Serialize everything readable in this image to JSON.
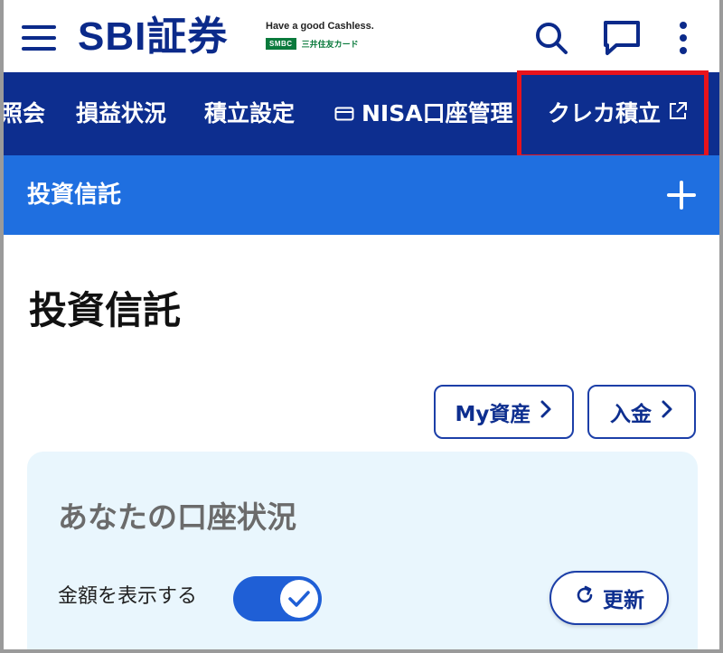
{
  "header": {
    "logo": "SBI証券",
    "tagline": "Have a good Cashless.",
    "smbc": "SMBC",
    "card_company": "三井住友カード"
  },
  "nav": {
    "items": [
      {
        "label": "照会"
      },
      {
        "label": "損益状況"
      },
      {
        "label": "積立設定"
      },
      {
        "label": "NISA口座管理"
      },
      {
        "label": "クレカ積立"
      }
    ]
  },
  "accordion": {
    "title": "投資信託"
  },
  "main": {
    "page_title": "投資信託",
    "my_assets_label": "My資産",
    "deposit_label": "入金",
    "account_card": {
      "title": "あなたの口座状況",
      "toggle_label": "金額を表示する",
      "toggle_on": true,
      "refresh_label": "更新"
    }
  },
  "colors": {
    "brand_navy": "#0d2e8f",
    "accent_blue": "#1f6fe0",
    "highlight_red": "#e8131c",
    "card_bg": "#e9f6fd"
  }
}
